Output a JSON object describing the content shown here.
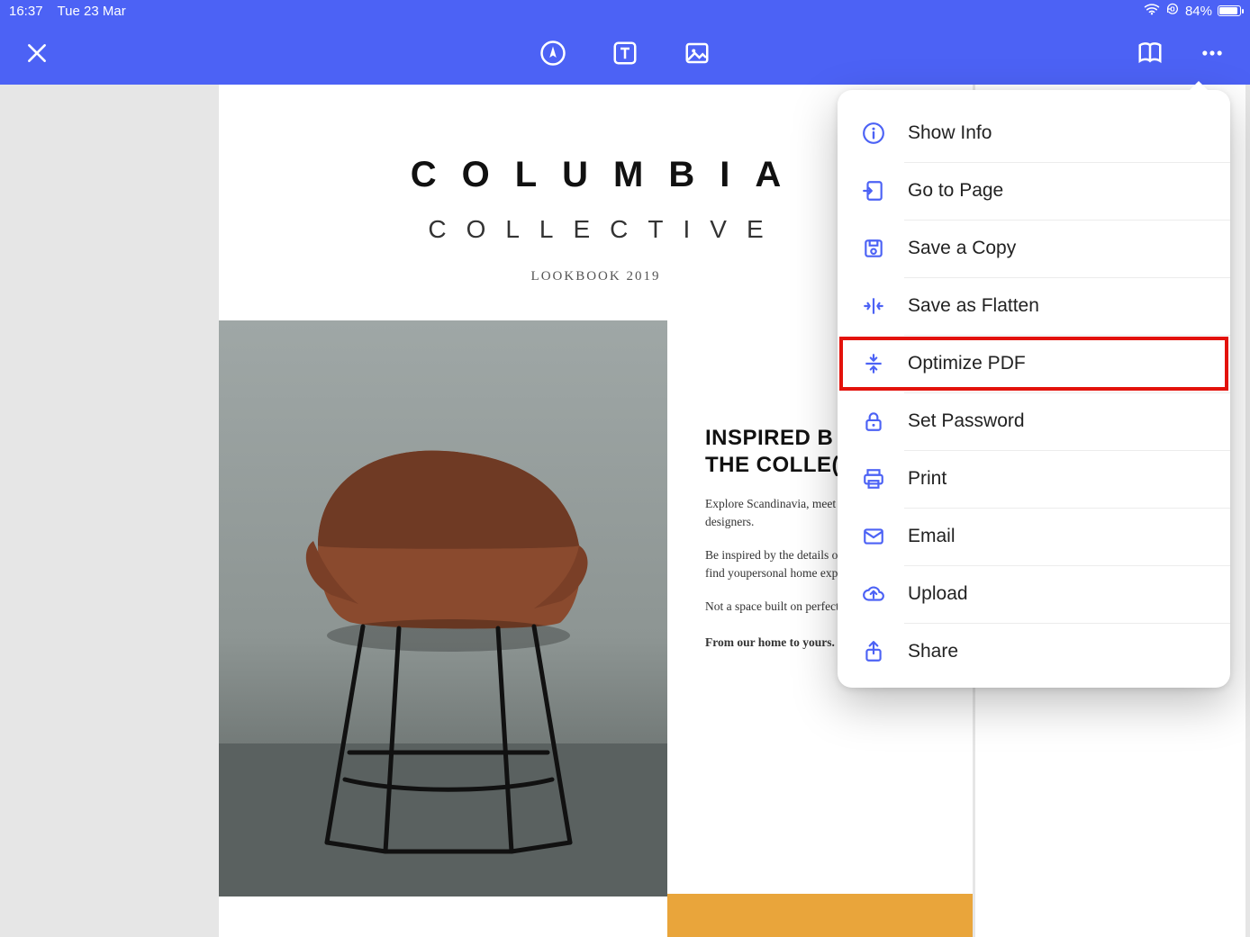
{
  "status": {
    "time": "16:37",
    "date": "Tue 23 Mar",
    "battery_pct": "84%"
  },
  "document": {
    "title": "COLUMBIA",
    "subtitle": "COLLECTIVE",
    "tagline": "LOOKBOOK 2019",
    "headline_line1": "INSPIRED B",
    "headline_line2": "THE COLLE(",
    "para1": "Explore Scandinavia, meet lo­and renowned designers.",
    "para2": "Be inspired by the details of c­design and passion to find you­personal home expression.",
    "para3": "Not a space built on perfectio­home made for living.",
    "signoff": "From our home to yours."
  },
  "menu": {
    "items": [
      {
        "id": "show-info",
        "label": "Show Info",
        "icon": "info-icon"
      },
      {
        "id": "go-to-page",
        "label": "Go to Page",
        "icon": "goto-page-icon"
      },
      {
        "id": "save-copy",
        "label": "Save a Copy",
        "icon": "save-icon"
      },
      {
        "id": "save-flatten",
        "label": "Save as Flatten",
        "icon": "flatten-icon"
      },
      {
        "id": "optimize-pdf",
        "label": "Optimize PDF",
        "icon": "optimize-icon",
        "highlighted": true
      },
      {
        "id": "set-password",
        "label": "Set Password",
        "icon": "lock-icon"
      },
      {
        "id": "print",
        "label": "Print",
        "icon": "print-icon"
      },
      {
        "id": "email",
        "label": "Email",
        "icon": "email-icon"
      },
      {
        "id": "upload",
        "label": "Upload",
        "icon": "upload-cloud-icon"
      },
      {
        "id": "share",
        "label": "Share",
        "icon": "share-icon"
      }
    ]
  },
  "colors": {
    "accent": "#4c62f5",
    "highlight_border": "#e3120b",
    "orange_band": "#e9a53b"
  }
}
